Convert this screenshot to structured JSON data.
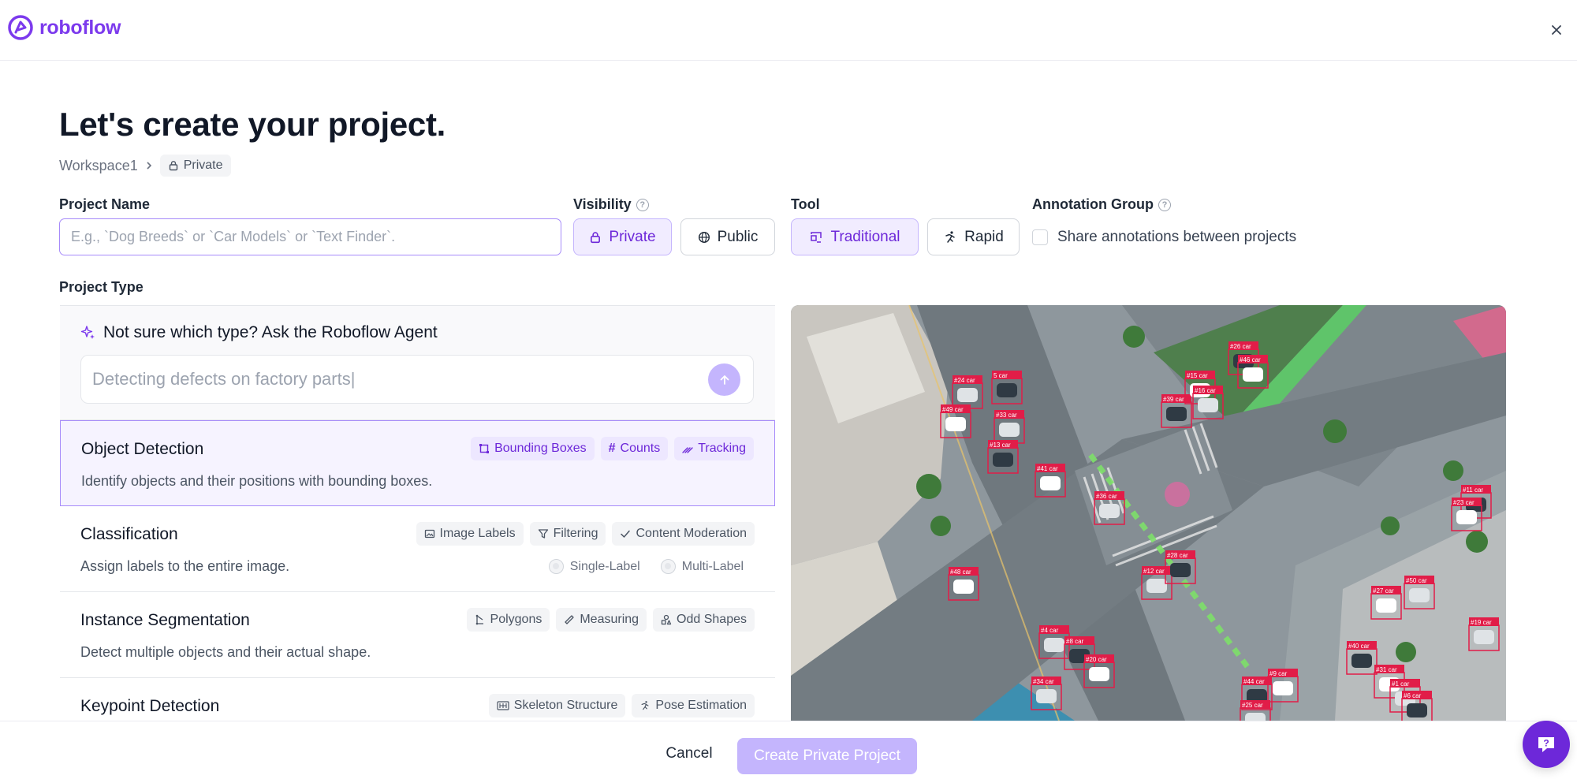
{
  "app": {
    "brand": "roboflow"
  },
  "header": {
    "title": "Let's create your project."
  },
  "breadcrumb": {
    "workspace": "Workspace1",
    "visibility": "Private"
  },
  "fields": {
    "project_name": {
      "label": "Project Name",
      "value": "",
      "placeholder": "E.g., `Dog Breeds` or `Car Models` or `Text Finder`."
    },
    "visibility": {
      "label": "Visibility",
      "options": [
        "Private",
        "Public"
      ],
      "selected": "Private"
    },
    "tool": {
      "label": "Tool",
      "options": [
        "Traditional",
        "Rapid"
      ],
      "selected": "Traditional"
    },
    "annotation_group": {
      "label": "Annotation Group",
      "checkbox_label": "Share annotations between projects",
      "checked": false
    }
  },
  "project_type": {
    "label": "Project Type",
    "agent": {
      "title": "Not sure which type? Ask the Roboflow Agent",
      "placeholder": "Detecting defects on factory parts|"
    },
    "types": [
      {
        "name": "Object Detection",
        "description": "Identify objects and their positions with bounding boxes.",
        "tags": [
          "Bounding Boxes",
          "Counts",
          "Tracking"
        ],
        "selected": true
      },
      {
        "name": "Classification",
        "description": "Assign labels to the entire image.",
        "tags": [
          "Image Labels",
          "Filtering",
          "Content Moderation"
        ],
        "radios": [
          "Single-Label",
          "Multi-Label"
        ]
      },
      {
        "name": "Instance Segmentation",
        "description": "Detect multiple objects and their actual shape.",
        "tags": [
          "Polygons",
          "Measuring",
          "Odd Shapes"
        ]
      },
      {
        "name": "Keypoint Detection",
        "description": "",
        "tags": [
          "Skeleton Structure",
          "Pose Estimation"
        ]
      }
    ]
  },
  "preview": {
    "detections": [
      {
        "label": "#24 car"
      },
      {
        "label": "5 car"
      },
      {
        "label": "#49 car"
      },
      {
        "label": "#33 car"
      },
      {
        "label": "#13 car"
      },
      {
        "label": "#41 car"
      },
      {
        "label": "#36 car"
      },
      {
        "label": "#39 car"
      },
      {
        "label": "#15 car"
      },
      {
        "label": "#16 car"
      },
      {
        "label": "#26 car"
      },
      {
        "label": "#46 car"
      },
      {
        "label": "#12 car"
      },
      {
        "label": "#28 car"
      },
      {
        "label": "#48 car"
      },
      {
        "label": "#4 car"
      },
      {
        "label": "#8 car"
      },
      {
        "label": "#20 car"
      },
      {
        "label": "#34 car"
      },
      {
        "label": "#44 car"
      },
      {
        "label": "#9 car"
      },
      {
        "label": "#25 car"
      },
      {
        "label": "#40 car"
      },
      {
        "label": "#31 car"
      },
      {
        "label": "#1 car"
      },
      {
        "label": "#6 car"
      },
      {
        "label": "#27 car"
      },
      {
        "label": "#50 car"
      },
      {
        "label": "#11 car"
      },
      {
        "label": "#23 car"
      },
      {
        "label": "#19 car"
      }
    ]
  },
  "footer": {
    "cancel": "Cancel",
    "create": "Create Private Project"
  },
  "colors": {
    "accent": "#7c3aed",
    "accent_light": "#c4b5fd",
    "selected_bg": "#f6f3ff",
    "detection": "#e11d48"
  }
}
